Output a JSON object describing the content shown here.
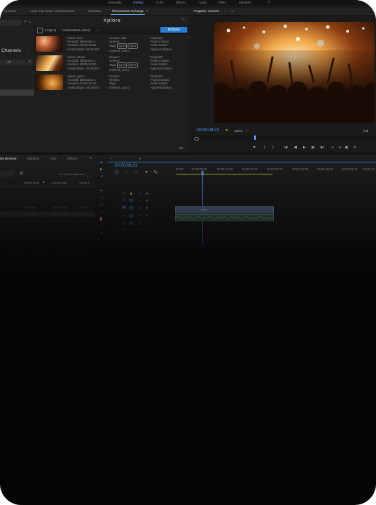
{
  "workspace_tabs": [
    "Assembly",
    "Editing",
    "Color",
    "Effects",
    "Audio",
    "Titles",
    "Libraries"
  ],
  "workspace_active": "Editing",
  "workspace_more": "»",
  "panel_tabs": [
    "Controls",
    "Audio Clip Mixer: skateboard02",
    "Metadata",
    "Primestream Xchange"
  ],
  "panel_active": "Primestream Xchange",
  "panel_menu": "≡",
  "program_monitor_tab": "Program: Concert",
  "program_monitor_menu": "≡",
  "xplore": {
    "title": "Xplore",
    "count_label": "0 (3pcs)",
    "sort_label": "creationDate (desc)",
    "actions_label": "Actions",
    "pagination": "2/2",
    "results": [
      {
        "col1": [
          "Name: fans",
          "recordId: d49aca81-1",
          "Duration: 00:00:28:20",
          "creationDate: 03-29-202"
        ],
        "col2": [
          "Creator: alan",
          "Version:",
          "Tags:",
          "markers_count:"
        ],
        "tags": [
          "Sport",
          "Sport"
        ],
        "col3": [
          "ProjectID:",
          "Project Status:",
          "Asset Status:",
          "Approval Status:"
        ]
      },
      {
        "col1": [
          "Name: drums",
          "recordId: d49aca81-1",
          "Duration: 00:00:10:19",
          "creationDate: 03-29-202"
        ],
        "col2": [
          "Creator:",
          "Version:",
          "Tags:",
          "markers_count:"
        ],
        "tags": [
          "Sport",
          "Sport"
        ],
        "col3": [
          "ProjectID:",
          "Project Status:",
          "Asset Status:",
          "Approval Status:"
        ]
      },
      {
        "col1": [
          "Name: guitar",
          "recordId: d49aca81-1",
          "Duration: 00:00:10:18",
          "creationDate: 03-29-202"
        ],
        "col2": [
          "Creator:",
          "Version:",
          "Tags:",
          "markers_count:"
        ],
        "tags": [],
        "col3": [
          "ProjectID:",
          "Project Status:",
          "Asset Status:",
          "Approval Status:"
        ]
      }
    ]
  },
  "left_panel": {
    "channels_label": "Channels",
    "filter_value": "All"
  },
  "program": {
    "timecode": "00:00:08:21",
    "zoom": "100%",
    "quality": "Full",
    "transport": [
      "▼",
      "{",
      "}",
      "|◀",
      "◀|",
      "▶",
      "|▶",
      "▶|",
      "⇥",
      "⇤",
      "▣",
      "⊙"
    ]
  },
  "project": {
    "tabs": [
      "dia Browser",
      "Libraries",
      "Info",
      "Effects"
    ],
    "more": "»",
    "search_value": "",
    "bin_icon_label": "Bi",
    "items_selected": "1 of 7 items selected",
    "columns": [
      "Frame Rate",
      "Media Start",
      "Media E"
    ],
    "rows": [
      [
        "25.97 fps",
        "00:00:00:00",
        "00:00:"
      ],
      [
        "29.97 fps",
        "00:00:00:00",
        "00:00:"
      ],
      [
        "25.97 fps",
        "00:00:00:00",
        "00:00"
      ]
    ]
  },
  "timeline": {
    "tab": "×",
    "timecode": "00:00:08:21",
    "ruler": [
      "00:00",
      "00:00:08:00",
      "00:00:16:00",
      "00:00:24:00",
      "00:00:32:00",
      "00:00:40:00",
      "00:00:48:00",
      "00:00:56:00",
      "00:01:04"
    ],
    "track_labels": [
      "V3",
      "V2",
      "V1",
      "A1",
      "A2",
      "A3"
    ],
    "clip_label": "fans",
    "master_label": "0.0"
  },
  "colors": {
    "accent": "#4a9eff",
    "active_tab": "#6ca7e8",
    "actions_button": "#2d7dd2"
  }
}
